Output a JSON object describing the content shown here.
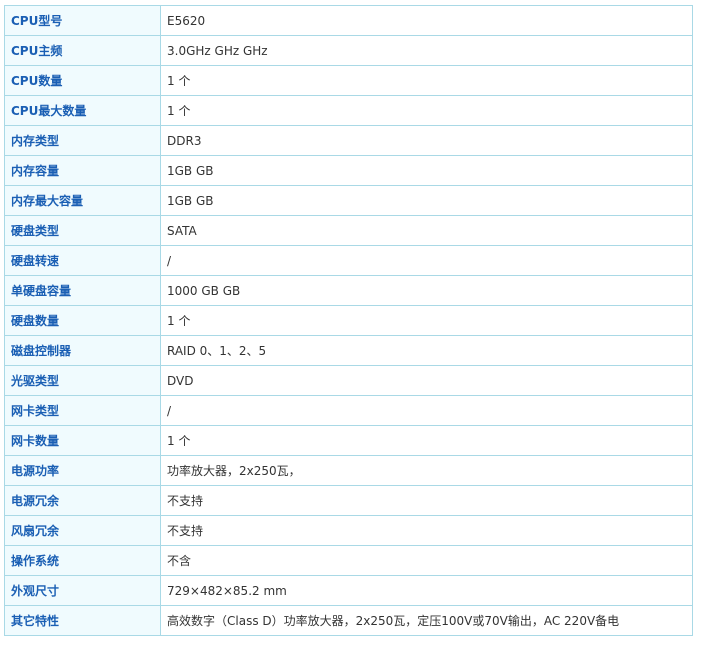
{
  "specs": [
    {
      "label": "CPU型号",
      "value": "E5620"
    },
    {
      "label": "CPU主频",
      "value": "3.0GHz GHz  GHz"
    },
    {
      "label": "CPU数量",
      "value": "1  个"
    },
    {
      "label": "CPU最大数量",
      "value": "1  个"
    },
    {
      "label": "内存类型",
      "value": "DDR3"
    },
    {
      "label": "内存容量",
      "value": "1GB  GB"
    },
    {
      "label": "内存最大容量",
      "value": "1GB  GB"
    },
    {
      "label": "硬盘类型",
      "value": "SATA"
    },
    {
      "label": "硬盘转速",
      "value": "/"
    },
    {
      "label": "单硬盘容量",
      "value": "1000 GB  GB"
    },
    {
      "label": "硬盘数量",
      "value": "1  个"
    },
    {
      "label": "磁盘控制器",
      "value": "RAID 0、1、2、5"
    },
    {
      "label": "光驱类型",
      "value": "DVD"
    },
    {
      "label": "网卡类型",
      "value": "/"
    },
    {
      "label": "网卡数量",
      "value": "1  个"
    },
    {
      "label": "电源功率",
      "value": "功率放大器，2x250瓦，"
    },
    {
      "label": "电源冗余",
      "value": "不支持"
    },
    {
      "label": "风扇冗余",
      "value": "不支持"
    },
    {
      "label": "操作系统",
      "value": "不含"
    },
    {
      "label": "外观尺寸",
      "value": "729×482×85.2  mm"
    },
    {
      "label": "其它特性",
      "value": "高效数字（Class D）功率放大器，2x250瓦，定压100V或70V输出，AC 220V备电"
    }
  ]
}
